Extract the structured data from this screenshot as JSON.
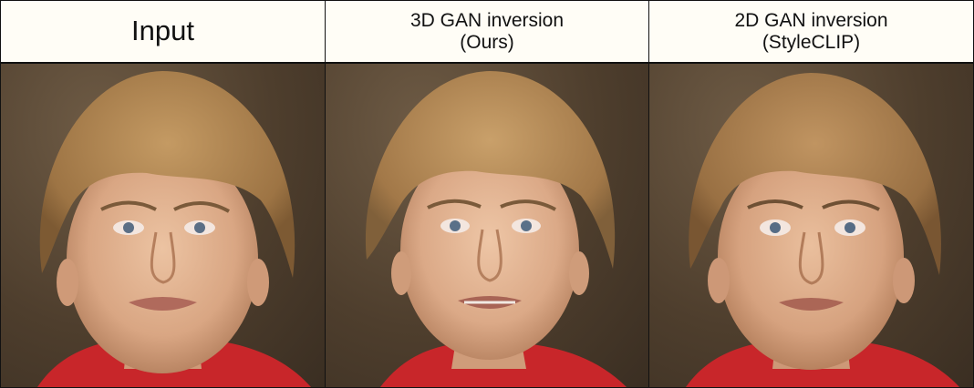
{
  "headers": {
    "input": "Input",
    "ours_line1": "3D GAN inversion",
    "ours_line2": "(Ours)",
    "clip_line1": "2D GAN inversion",
    "clip_line2": "(StyleCLIP)"
  },
  "colors": {
    "background_dark": "#3a2e22",
    "skin": "#dcb08f",
    "hair": "#a9804f",
    "shirt": "#c8262a",
    "header_bg": "#fffdf6"
  },
  "panels": [
    {
      "name": "input-face-photo"
    },
    {
      "name": "ours-face-photo"
    },
    {
      "name": "styleclip-face-photo"
    }
  ]
}
